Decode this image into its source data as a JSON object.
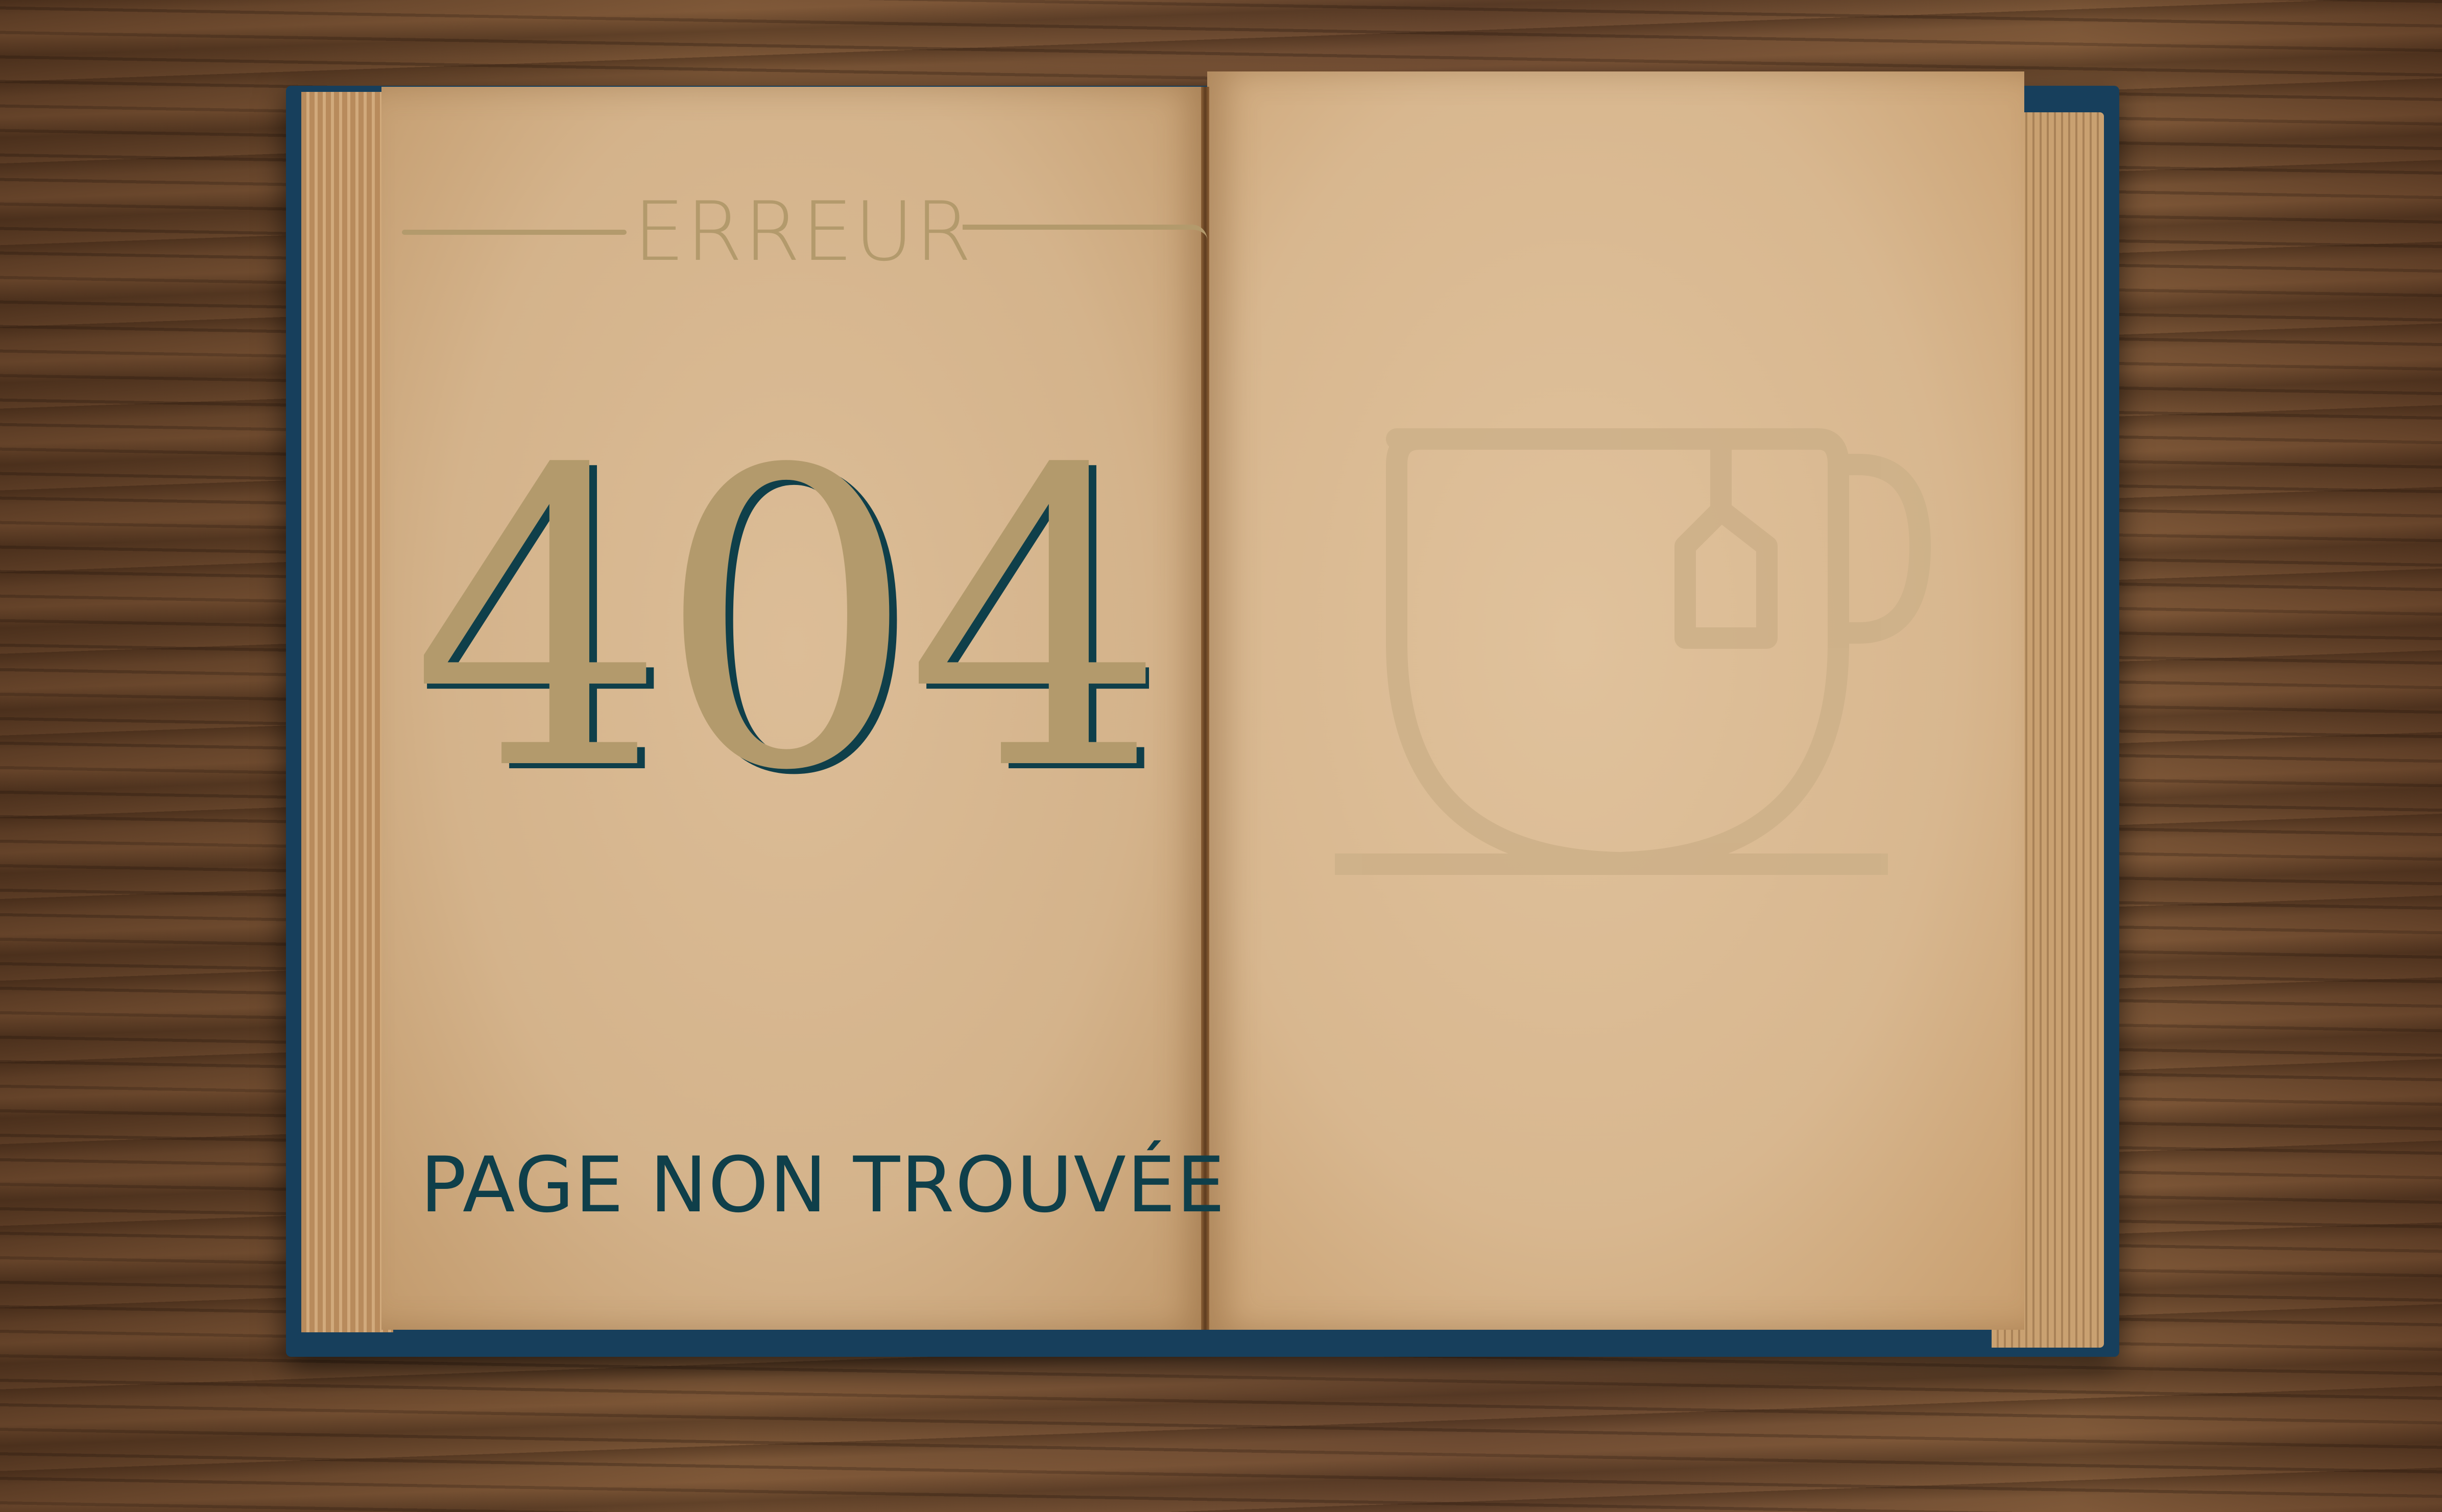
{
  "error_page": {
    "eyebrow": "ERREUR",
    "code": "404",
    "message": "PAGE NON TROUVÉE"
  },
  "icons": {
    "illustration": "tea-mug-icon"
  },
  "colors": {
    "accent_tan": "#b39a6c",
    "dark_teal": "#0f3f4a",
    "cover_blue": "#173f5c"
  }
}
